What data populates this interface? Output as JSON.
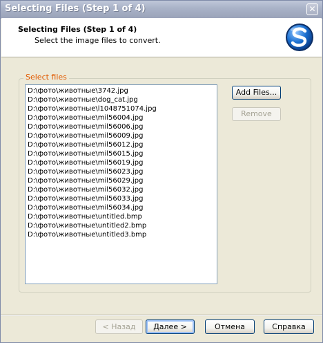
{
  "window": {
    "title": "Selecting Files (Step 1 of 4)",
    "close_glyph": "✕"
  },
  "header": {
    "title": "Selecting Files (Step 1 of 4)",
    "subtitle": "Select the image files to convert.",
    "logo_icon": "s-logo-icon"
  },
  "select_files": {
    "label": "Select files",
    "files": [
      "D:\\фото\\животные\\3742.jpg",
      "D:\\фото\\животные\\dog_cat.jpg",
      "D:\\фото\\животные\\l1048751074.jpg",
      "D:\\фото\\животные\\mil56004.jpg",
      "D:\\фото\\животные\\mil56006.jpg",
      "D:\\фото\\животные\\mil56009.jpg",
      "D:\\фото\\животные\\mil56012.jpg",
      "D:\\фото\\животные\\mil56015.jpg",
      "D:\\фото\\животные\\mil56019.jpg",
      "D:\\фото\\животные\\mil56023.jpg",
      "D:\\фото\\животные\\mil56029.jpg",
      "D:\\фото\\животные\\mil56032.jpg",
      "D:\\фото\\животные\\mil56033.jpg",
      "D:\\фото\\животные\\mil56034.jpg",
      "D:\\фото\\животные\\untitled.bmp",
      "D:\\фото\\животные\\untitled2.bmp",
      "D:\\фото\\животные\\untitled3.bmp"
    ],
    "add_files_label": "Add Files...",
    "remove_label": "Remove"
  },
  "footer": {
    "back_label": "< Назад",
    "next_label": "Далее >",
    "cancel_label": "Отмена",
    "help_label": "Справка"
  },
  "colors": {
    "group_label": "#e15a00",
    "logo_blue": "#1a6fd0"
  }
}
